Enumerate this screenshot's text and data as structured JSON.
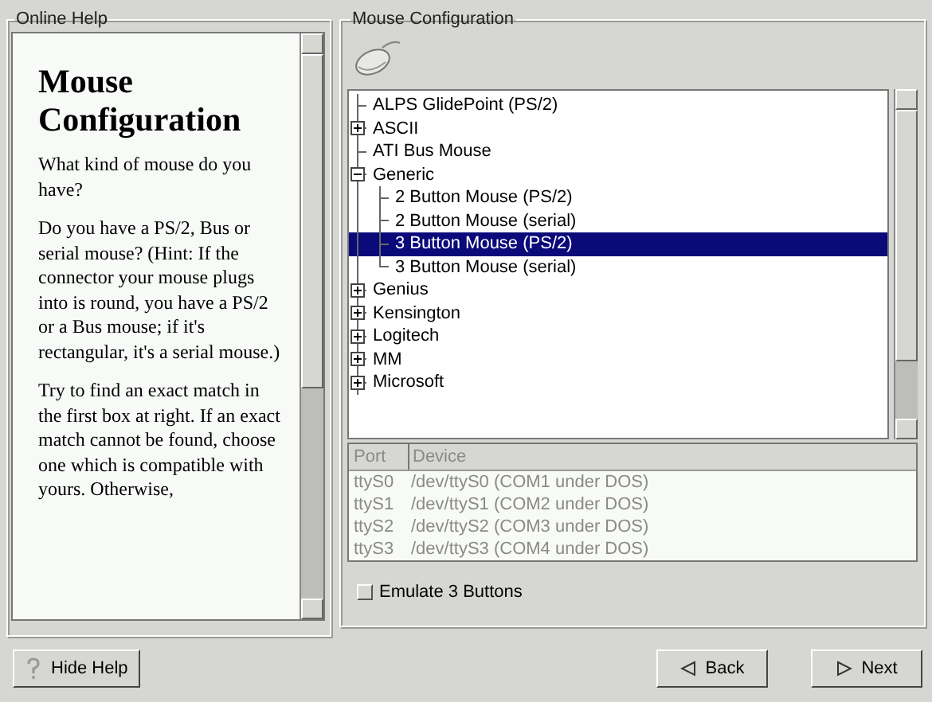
{
  "help_panel": {
    "title": "Online Help",
    "heading": "Mouse Configuration",
    "paragraphs": [
      "What kind of mouse do you have?",
      "Do you have a PS/2, Bus or serial mouse? (Hint: If the connector your mouse plugs into is round, you have a PS/2 or a Bus mouse; if it's rectangular, it's a serial mouse.)",
      "Try to find an exact match in the first box at right. If an exact match cannot be found, choose one which is compatible with yours. Otherwise,"
    ]
  },
  "config_panel": {
    "title": "Mouse Configuration",
    "mouse_tree": [
      {
        "label": "ALPS GlidePoint (PS/2)",
        "selected": false
      },
      {
        "label": "ASCII",
        "selected": false,
        "expanded": false
      },
      {
        "label": "ATI Bus Mouse",
        "selected": false
      },
      {
        "label": "Generic",
        "selected": false,
        "expanded": true,
        "children": [
          {
            "label": "2 Button Mouse (PS/2)",
            "selected": false
          },
          {
            "label": "2 Button Mouse (serial)",
            "selected": false
          },
          {
            "label": "3 Button Mouse (PS/2)",
            "selected": true
          },
          {
            "label": "3 Button Mouse (serial)",
            "selected": false
          }
        ]
      },
      {
        "label": "Genius",
        "selected": false,
        "expanded": false
      },
      {
        "label": "Kensington",
        "selected": false,
        "expanded": false
      },
      {
        "label": "Logitech",
        "selected": false,
        "expanded": false
      },
      {
        "label": "MM",
        "selected": false,
        "expanded": false
      },
      {
        "label": "Microsoft",
        "selected": false,
        "expanded": false
      }
    ],
    "port_table": {
      "disabled": true,
      "columns": [
        "Port",
        "Device"
      ],
      "rows": [
        [
          "ttyS0",
          "/dev/ttyS0 (COM1 under DOS)"
        ],
        [
          "ttyS1",
          "/dev/ttyS1 (COM2 under DOS)"
        ],
        [
          "ttyS2",
          "/dev/ttyS2 (COM3 under DOS)"
        ],
        [
          "ttyS3",
          "/dev/ttyS3 (COM4 under DOS)"
        ]
      ]
    },
    "emulate_checkbox": {
      "label": "Emulate 3 Buttons",
      "checked": false
    }
  },
  "buttons": {
    "hide_help": "Hide Help",
    "back": "Back",
    "next": "Next"
  }
}
